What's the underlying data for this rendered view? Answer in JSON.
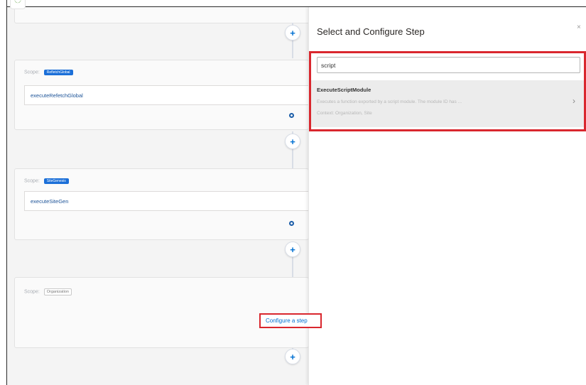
{
  "panel": {
    "title": "Select and Configure Step",
    "close_icon": "×",
    "search_value": "script",
    "result": {
      "name": "ExecuteScriptModule",
      "description": "Executes a function exported by a script module. The module ID has ...",
      "context": "Context: Organization, Site",
      "chevron": "›"
    }
  },
  "canvas": {
    "plus_icon": "+",
    "scopes": [
      {
        "label": "Scope:",
        "badge": "RefletchGlobal",
        "step": "executeRefetchGlobal"
      },
      {
        "label": "Scope:",
        "badge": "SiteGenesis",
        "step": "executeSiteGen"
      },
      {
        "label": "Scope:",
        "badge": "Organization"
      }
    ],
    "configure_button": "Configure a step"
  },
  "colors": {
    "accent": "#0070d2",
    "highlight": "#d9272e",
    "badge": "#1b6fd8"
  }
}
